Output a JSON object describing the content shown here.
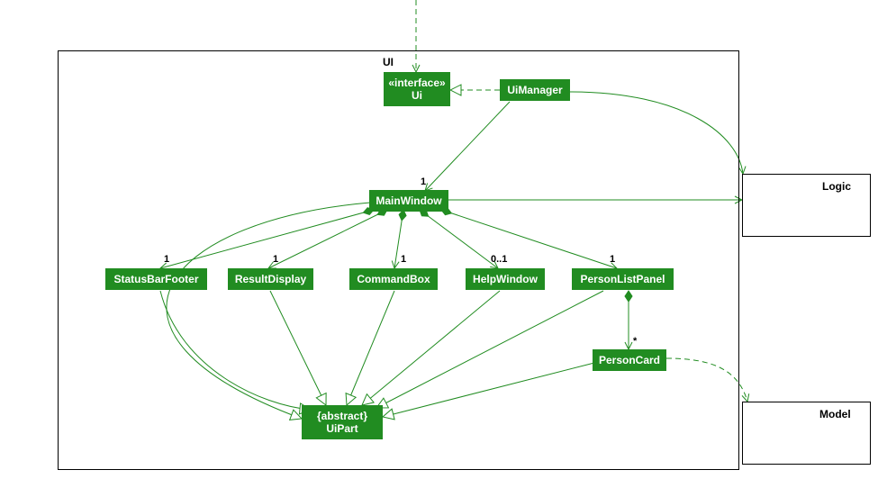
{
  "packages": {
    "ui_title": "UI",
    "logic_title": "Logic",
    "model_title": "Model"
  },
  "classes": {
    "ui_interface_stereo": "«interface»",
    "ui_interface_name": "Ui",
    "ui_manager": "UiManager",
    "main_window": "MainWindow",
    "status_bar_footer": "StatusBarFooter",
    "result_display": "ResultDisplay",
    "command_box": "CommandBox",
    "help_window": "HelpWindow",
    "person_list_panel": "PersonListPanel",
    "person_card": "PersonCard",
    "ui_part_stereo": "{abstract}",
    "ui_part_name": "UiPart"
  },
  "mult": {
    "mw": "1",
    "sbf": "1",
    "rd": "1",
    "cb": "1",
    "hw": "0..1",
    "plp": "1",
    "pc": "*"
  },
  "colors": {
    "class_fill": "#218c21",
    "edge": "#218c21"
  }
}
